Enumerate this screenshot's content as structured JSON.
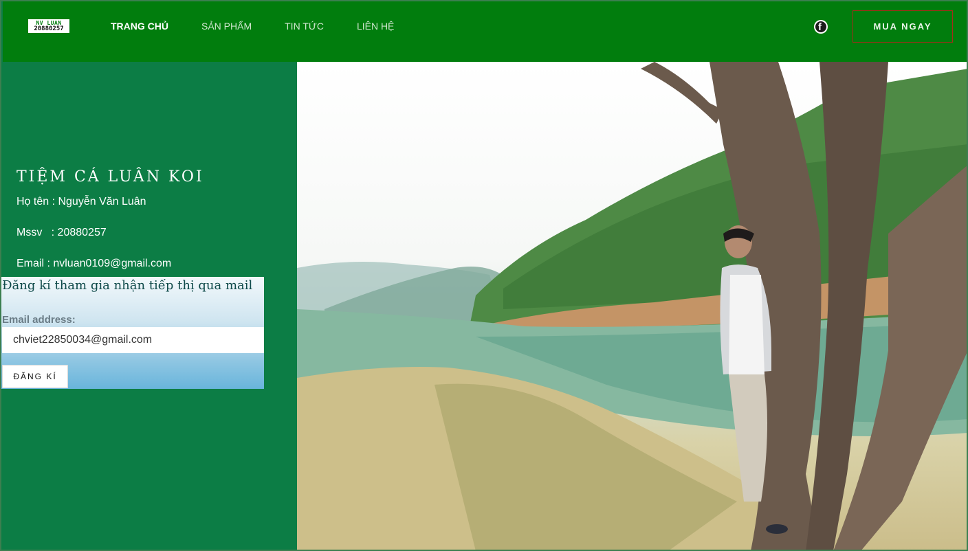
{
  "header": {
    "logo_line1": "NV LUAN",
    "logo_line2": "20880257",
    "nav": [
      "TRANG CHỦ",
      "SẢN PHẨM",
      "TIN TỨC",
      "LIÊN HỆ"
    ],
    "facebook_icon": "facebook-icon",
    "buy_label": "MUA NGAY"
  },
  "profile": {
    "shop_name": "TIỆM CÁ LUÂN KOI",
    "name_line": "Họ tên : Nguyễn Văn Luân",
    "id_line": "Mssv   : 20880257",
    "email_line": "Email : nvluan0109@gmail.com"
  },
  "subscribe": {
    "title": "Đăng kí tham gia nhận tiếp thị qua mail",
    "email_label": "Email address:",
    "email_value": "chviet22850034@gmail.com",
    "submit_label": "ĐĂNG KÍ"
  },
  "colors": {
    "header_bg": "#017d0d",
    "panel_bg": "#0c7d45",
    "button_border": "#a52a1a"
  }
}
